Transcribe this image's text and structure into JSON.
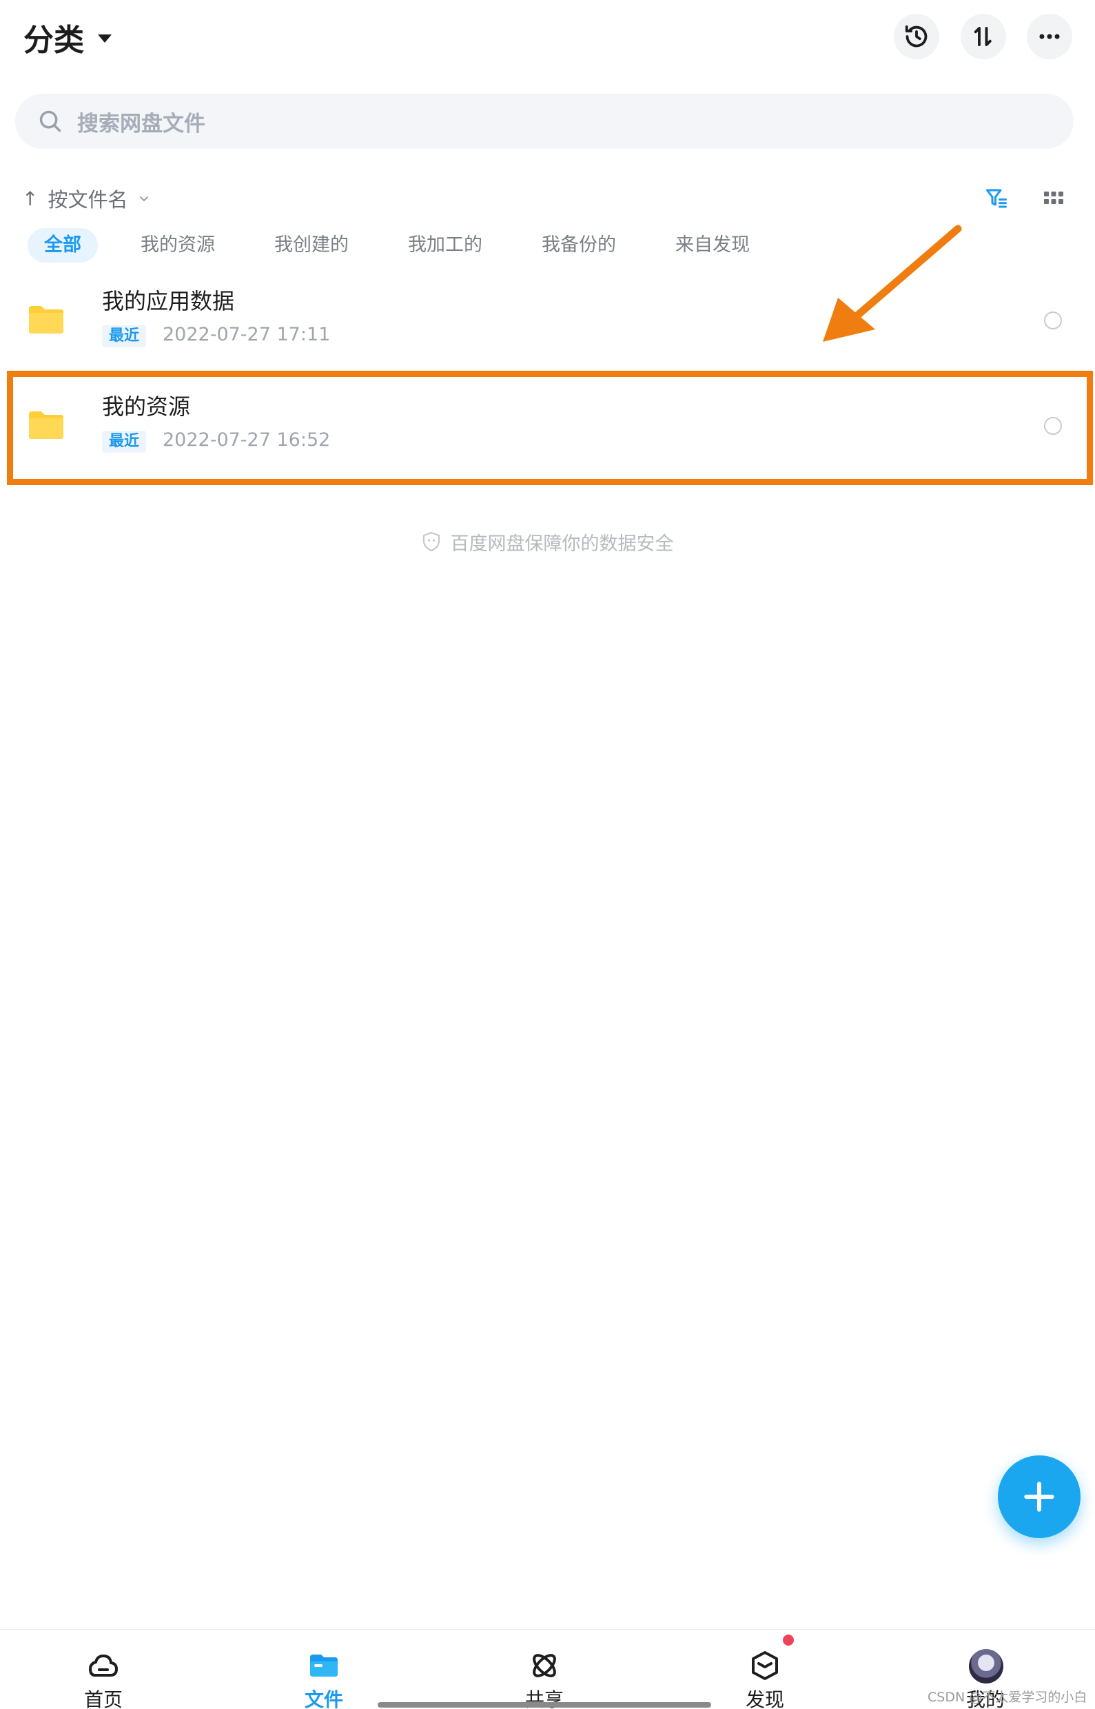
{
  "header": {
    "title": "分类",
    "buttons": [
      "history-icon",
      "transfer-icon",
      "more-icon"
    ]
  },
  "search": {
    "placeholder": "搜索网盘文件"
  },
  "sort": {
    "arrow": "↑",
    "label": "按文件名"
  },
  "tabs": [
    {
      "label": "全部",
      "active": true
    },
    {
      "label": "我的资源"
    },
    {
      "label": "我创建的"
    },
    {
      "label": "我加工的"
    },
    {
      "label": "我备份的"
    },
    {
      "label": "来自发现"
    }
  ],
  "files": [
    {
      "name": "我的应用数据",
      "badge": "最近",
      "time": "2022-07-27  17:11"
    },
    {
      "name": "我的资源",
      "badge": "最近",
      "time": "2022-07-27  16:52"
    }
  ],
  "security_note": "百度网盘保障你的数据安全",
  "nav": [
    {
      "label": "首页",
      "icon": "cloud-icon"
    },
    {
      "label": "文件",
      "icon": "folder-icon",
      "active": true
    },
    {
      "label": "共享",
      "icon": "share-icon"
    },
    {
      "label": "发现",
      "icon": "cube-icon"
    },
    {
      "label": "我的",
      "icon": "avatar"
    }
  ],
  "watermark": "CSDN @不太爱学习的小白",
  "colors": {
    "accent": "#1a9af0",
    "highlight": "#ef7d10",
    "folder": "#ffcf3a"
  }
}
